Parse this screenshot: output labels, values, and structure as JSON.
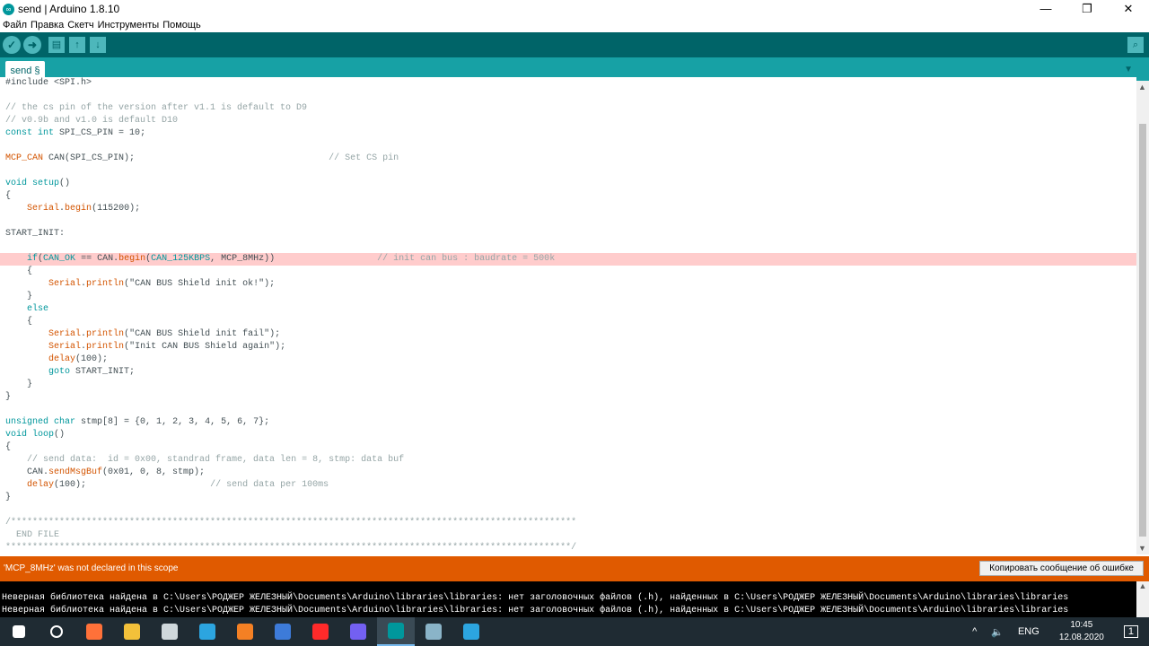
{
  "window": {
    "title": "send | Arduino 1.8.10",
    "minimize": "—",
    "maximize": "❐",
    "close": "✕"
  },
  "menu": [
    "Файл",
    "Правка",
    "Скетч",
    "Инструменты",
    "Помощь"
  ],
  "toolbar": {
    "verify": "✓",
    "upload": "➜",
    "new": "▤",
    "open": "↑",
    "save": "↓",
    "serial": "⌕"
  },
  "tab": {
    "label": "send §",
    "menu": "▼"
  },
  "code": [
    [
      [
        "#include <SPI.h>",
        ""
      ]
    ],
    [],
    [
      [
        "// the cs pin of the version after v1.1 is default to D9",
        "cm"
      ]
    ],
    [
      [
        "// v0.9b and v1.0 is default D10",
        "cm"
      ]
    ],
    [
      [
        "const",
        "kw"
      ],
      [
        " ",
        ""
      ],
      [
        "int",
        "kw"
      ],
      [
        " SPI_CS_PIN = 10;",
        ""
      ]
    ],
    [],
    [
      [
        "MCP_CAN",
        "fn"
      ],
      [
        " CAN(SPI_CS_PIN);                                    ",
        ""
      ],
      [
        "// Set CS pin",
        "cm"
      ]
    ],
    [],
    [
      [
        "void",
        "kw"
      ],
      [
        " ",
        ""
      ],
      [
        "setup",
        "kw"
      ],
      [
        "()",
        ""
      ]
    ],
    [
      [
        "{",
        ""
      ]
    ],
    [
      [
        "    ",
        ""
      ],
      [
        "Serial",
        "fn"
      ],
      [
        ".",
        ""
      ],
      [
        "begin",
        "fn"
      ],
      [
        "(115200);",
        ""
      ]
    ],
    [],
    [
      [
        "START_INIT:",
        ""
      ]
    ],
    [],
    [
      [
        "    ",
        ""
      ],
      [
        "if",
        "kw"
      ],
      [
        "(",
        ""
      ],
      [
        "CAN_OK",
        "ct"
      ],
      [
        " == CAN.",
        ""
      ],
      [
        "begin",
        "fn"
      ],
      [
        "(",
        ""
      ],
      [
        "CAN_125KBPS",
        "ct"
      ],
      [
        ", MCP_8MHz))                   ",
        ""
      ],
      [
        "// init can bus : baudrate = 500k",
        "cm"
      ]
    ],
    [
      [
        "    {",
        ""
      ]
    ],
    [
      [
        "        ",
        ""
      ],
      [
        "Serial",
        "fn"
      ],
      [
        ".",
        ""
      ],
      [
        "println",
        "fn"
      ],
      [
        "(\"CAN BUS Shield init ok!\");",
        ""
      ]
    ],
    [
      [
        "    }",
        ""
      ]
    ],
    [
      [
        "    ",
        ""
      ],
      [
        "else",
        "kw"
      ]
    ],
    [
      [
        "    {",
        ""
      ]
    ],
    [
      [
        "        ",
        ""
      ],
      [
        "Serial",
        "fn"
      ],
      [
        ".",
        ""
      ],
      [
        "println",
        "fn"
      ],
      [
        "(\"CAN BUS Shield init fail\");",
        ""
      ]
    ],
    [
      [
        "        ",
        ""
      ],
      [
        "Serial",
        "fn"
      ],
      [
        ".",
        ""
      ],
      [
        "println",
        "fn"
      ],
      [
        "(\"Init CAN BUS Shield again\");",
        ""
      ]
    ],
    [
      [
        "        ",
        ""
      ],
      [
        "delay",
        "fn"
      ],
      [
        "(100);",
        ""
      ]
    ],
    [
      [
        "        ",
        ""
      ],
      [
        "goto",
        "kw"
      ],
      [
        " START_INIT;",
        ""
      ]
    ],
    [
      [
        "    }",
        ""
      ]
    ],
    [
      [
        "}",
        ""
      ]
    ],
    [],
    [
      [
        "unsigned",
        "kw"
      ],
      [
        " ",
        ""
      ],
      [
        "char",
        "kw"
      ],
      [
        " stmp[8] = {0, 1, 2, 3, 4, 5, 6, 7};",
        ""
      ]
    ],
    [
      [
        "void",
        "kw"
      ],
      [
        " ",
        ""
      ],
      [
        "loop",
        "kw"
      ],
      [
        "()",
        ""
      ]
    ],
    [
      [
        "{",
        ""
      ]
    ],
    [
      [
        "    ",
        ""
      ],
      [
        "// send data:  id = 0x00, standrad frame, data len = 8, stmp: data buf",
        "cm"
      ]
    ],
    [
      [
        "    CAN.",
        ""
      ],
      [
        "sendMsgBuf",
        "fn"
      ],
      [
        "(0x01, 0, 8, stmp);",
        ""
      ]
    ],
    [
      [
        "    ",
        ""
      ],
      [
        "delay",
        "fn"
      ],
      [
        "(100);                       ",
        ""
      ],
      [
        "// send data per 100ms",
        "cm"
      ]
    ],
    [
      [
        "}",
        ""
      ]
    ],
    [],
    [
      [
        "/*********************************************************************************************************",
        "cm"
      ]
    ],
    [
      [
        "  END FILE",
        "cm"
      ]
    ],
    [
      [
        "*********************************************************************************************************/",
        "cm"
      ]
    ]
  ],
  "error_line_index": 14,
  "error": {
    "message": "'MCP_8MHz' was not declared in this scope",
    "copy_button": "Копировать сообщение об ошибке"
  },
  "console": [
    "Неверная библиотека найдена в C:\\Users\\РОДЖЕР ЖЕЛЕЗНЫЙ\\Documents\\Arduino\\libraries\\libraries: нет заголовочных файлов (.h), найденных в C:\\Users\\РОДЖЕР ЖЕЛЕЗНЫЙ\\Documents\\Arduino\\libraries\\libraries",
    "Неверная библиотека найдена в C:\\Users\\РОДЖЕР ЖЕЛЕЗНЫЙ\\Documents\\Arduino\\libraries\\libraries: нет заголовочных файлов (.h), найденных в C:\\Users\\РОДЖЕР ЖЕЛЕЗНЫЙ\\Documents\\Arduino\\libraries\\libraries"
  ],
  "taskbar": {
    "apps": [
      {
        "name": "start",
        "color": "#ffffff"
      },
      {
        "name": "search",
        "color": "#ffffff"
      },
      {
        "name": "firefox",
        "color": "#ff7139"
      },
      {
        "name": "file-explorer",
        "color": "#f3c13a"
      },
      {
        "name": "app",
        "color": "#cfd8dc"
      },
      {
        "name": "telegram",
        "color": "#2ca5e0"
      },
      {
        "name": "media",
        "color": "#f48024"
      },
      {
        "name": "paint",
        "color": "#3d7bd9"
      },
      {
        "name": "yandex-browser",
        "color": "#ff2a2a"
      },
      {
        "name": "viber",
        "color": "#7360f2"
      },
      {
        "name": "arduino",
        "color": "#00979c"
      },
      {
        "name": "notepad",
        "color": "#8ab4c8"
      },
      {
        "name": "telegram-2",
        "color": "#2ca5e0"
      }
    ],
    "active_app": "arduino",
    "tray": {
      "up": "^",
      "volume": "🔈",
      "lang": "ENG",
      "time": "10:45",
      "date": "12.08.2020",
      "notifications": "1"
    }
  }
}
